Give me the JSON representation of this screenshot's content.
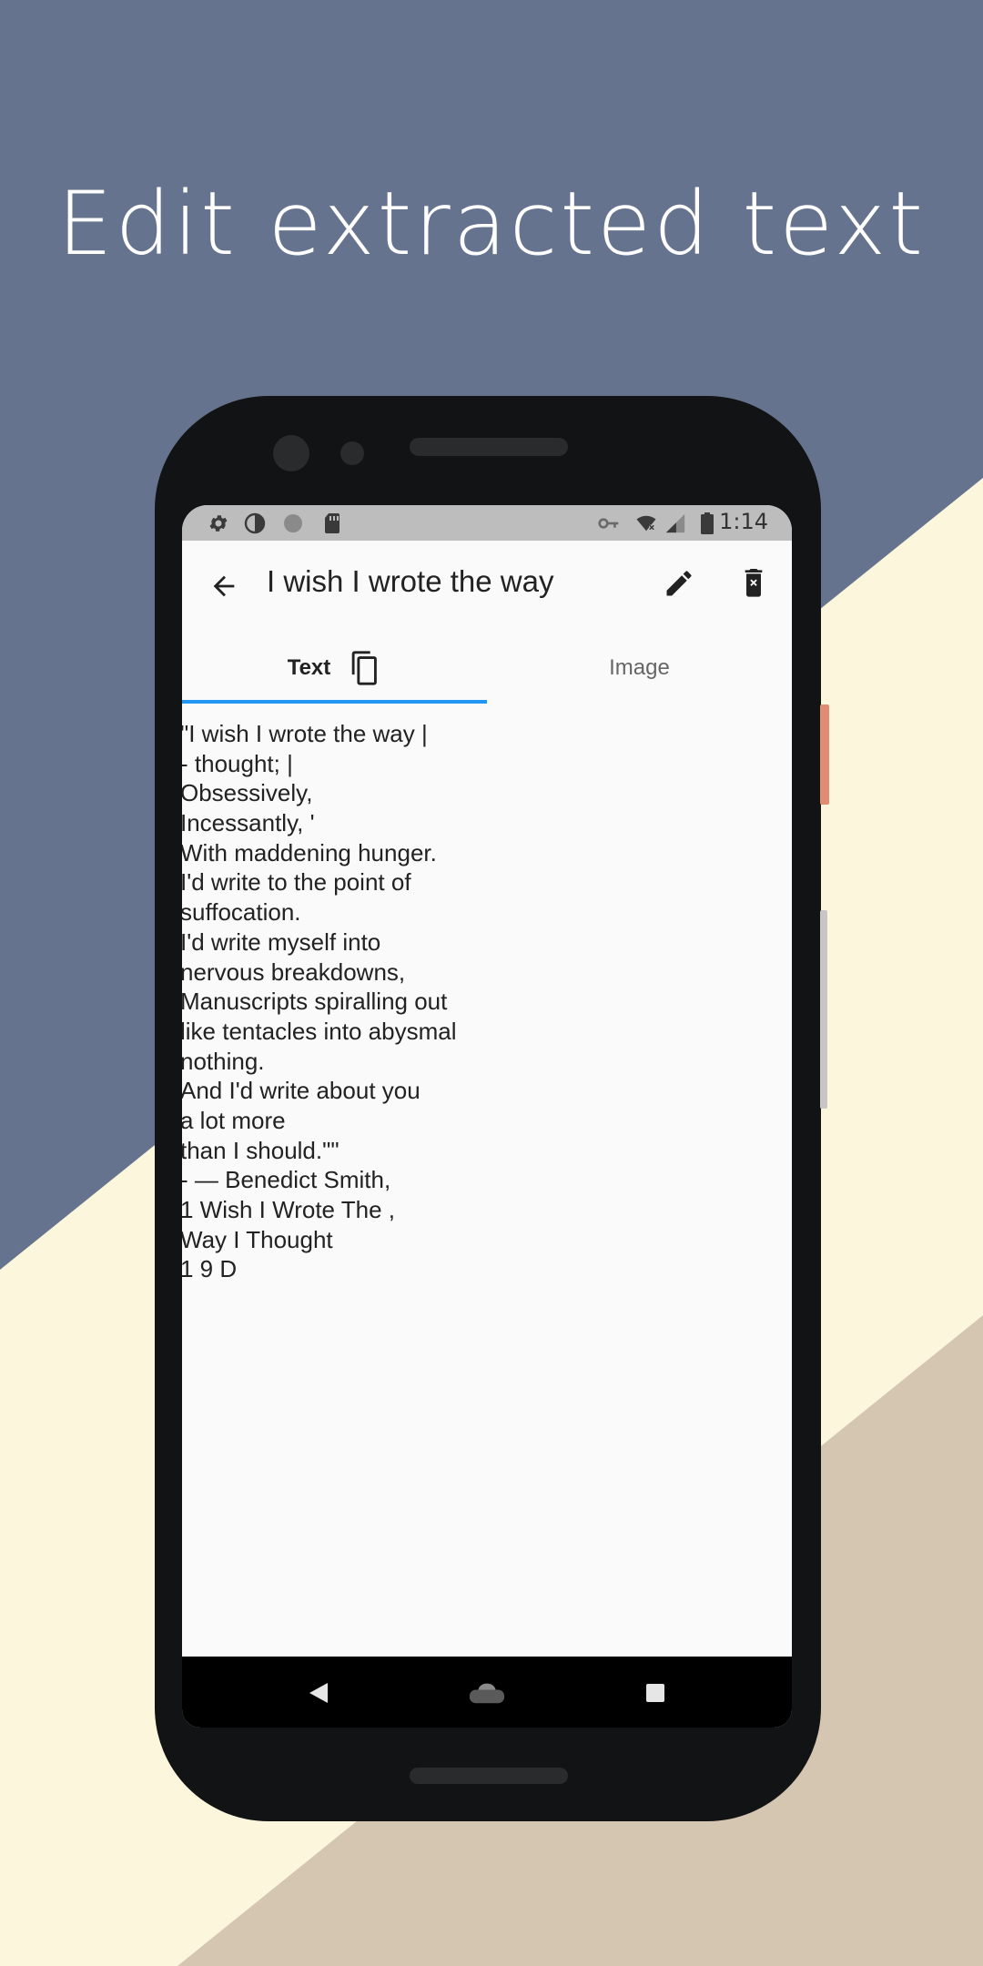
{
  "headline": "Edit extracted text",
  "colors": {
    "bg_blue": "#66738e",
    "bg_cream": "#fcf7dc",
    "bg_tan": "#d5c6b1",
    "tab_indicator": "#2196f3"
  },
  "status_bar": {
    "time": "1:14",
    "left_icons": [
      "settings-icon",
      "contrast-icon",
      "circle-icon",
      "sd-card-icon"
    ],
    "right_icons": [
      "vpn-key-icon",
      "wifi-off-icon",
      "signal-icon",
      "battery-icon"
    ]
  },
  "app_bar": {
    "title": "I wish I wrote the way",
    "back_icon": "arrow-back-icon",
    "edit_icon": "pencil-icon",
    "delete_icon": "delete-icon"
  },
  "tabs": [
    {
      "label": "Text",
      "active": true,
      "icon": "copy-icon"
    },
    {
      "label": "Image",
      "active": false
    }
  ],
  "extracted_text": [
    "\"I wish I wrote the way |",
    "- thought; |",
    "Obsessively,",
    "Incessantly, '",
    "With maddening hunger.",
    "I'd write to the point of",
    "suffocation.",
    "I'd write myself into",
    "nervous breakdowns,",
    "Manuscripts spiralling out",
    "like tentacles into abysmal",
    "nothing.",
    "And I'd write about you",
    "a lot more",
    "than I should.\"\"",
    "- — Benedict Smith,",
    "1 Wish I Wrote The ,",
    "Way I Thought",
    "1 9 D"
  ],
  "nav_bar": {
    "back": "nav-back-icon",
    "home": "nav-home-icon",
    "recents": "nav-recents-icon"
  }
}
